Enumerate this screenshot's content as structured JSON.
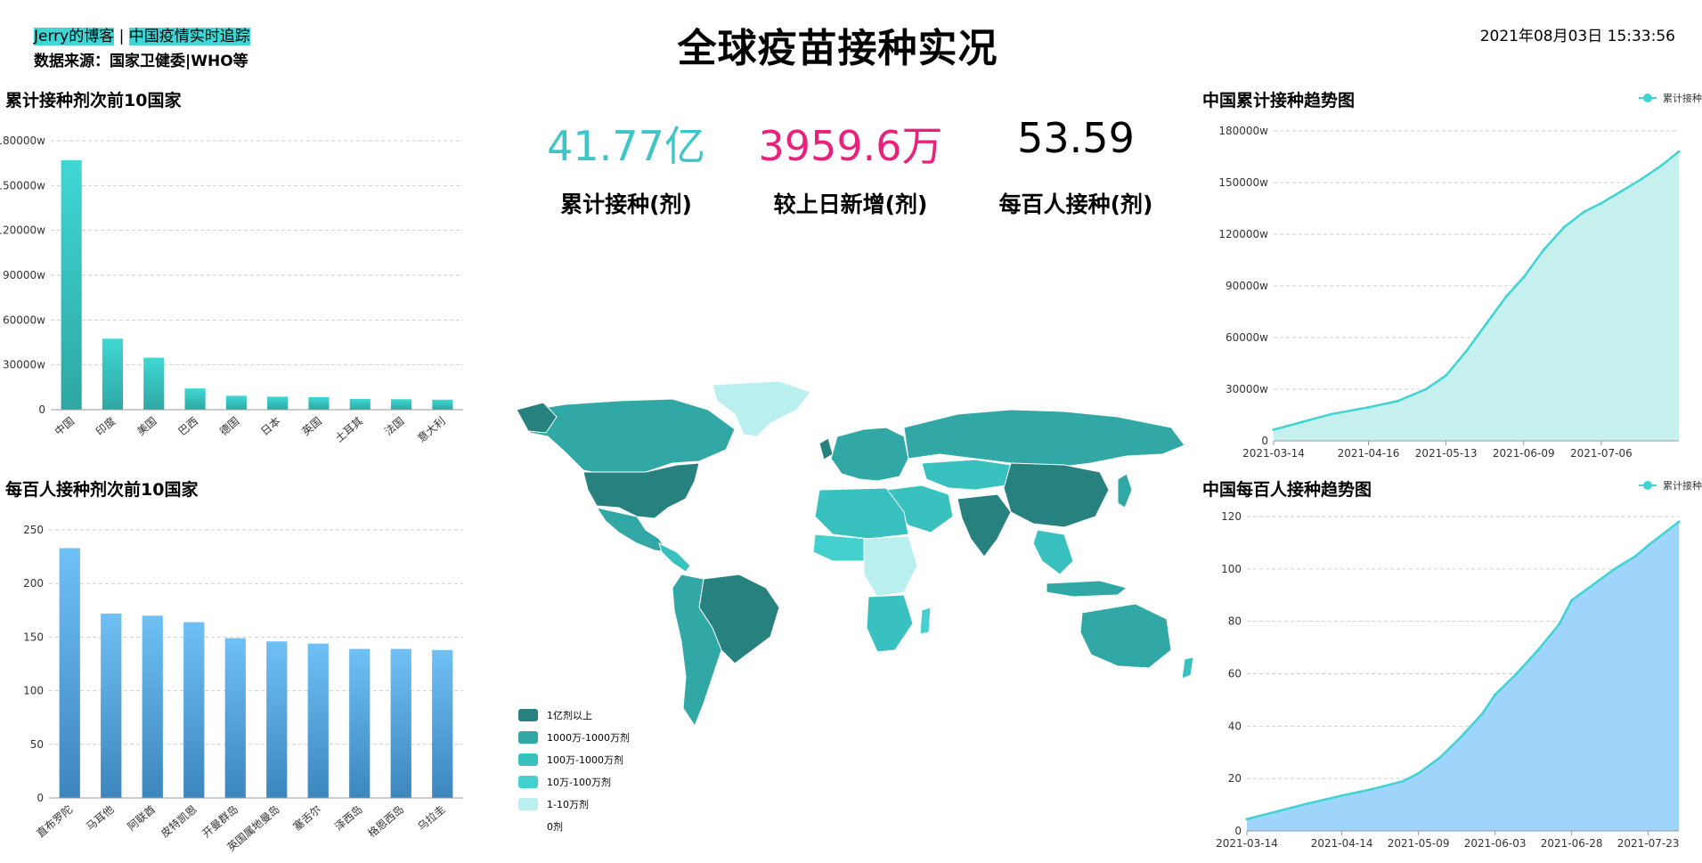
{
  "header": {
    "blog_link": "Jerry的博客",
    "separator": "|",
    "tracker_link": "中国疫情实时追踪",
    "source": "数据来源：国家卫健委|WHO等",
    "title": "全球疫苗接种实况",
    "datetime": "2021年08月03日 15:33:56"
  },
  "kpis": [
    {
      "value": "41.77亿",
      "label": "累计接种(剂)",
      "color": "#3ec5c8"
    },
    {
      "value": "3959.6万",
      "label": "较上日新增(剂)",
      "color": "#e8217a"
    },
    {
      "value": "53.59",
      "label": "每百人接种(剂)",
      "color": "#000000"
    }
  ],
  "colors": {
    "teal_top": "#3fd8d4",
    "teal_bottom": "#2ea7a3",
    "blue_top": "#6fc0f5",
    "blue_bottom": "#3c86bd",
    "line": "#40d3d3",
    "area_teal": "#c6f0ee",
    "area_blue": "#9fd5fb",
    "grid": "#cfcfcf"
  },
  "chart_data": [
    {
      "id": "cum-top10",
      "type": "bar",
      "title": "累计接种剂次前10国家",
      "categories": [
        "中国",
        "印度",
        "美国",
        "巴西",
        "德国",
        "日本",
        "英国",
        "土耳其",
        "法国",
        "意大利"
      ],
      "values": [
        167000,
        47500,
        34800,
        14200,
        9300,
        8700,
        8400,
        7200,
        7000,
        6700
      ],
      "yticks": [
        "0",
        "30000w",
        "60000w",
        "90000w",
        "120000w",
        "150000w",
        "180000w"
      ],
      "ylim": [
        0,
        180000
      ]
    },
    {
      "id": "per100-top10",
      "type": "bar",
      "title": "每百人接种剂次前10国家",
      "categories": [
        "直布罗陀",
        "马耳他",
        "阿联酋",
        "皮特凯恩",
        "开曼群岛",
        "英国属地曼岛",
        "塞舌尔",
        "泽西岛",
        "格恩西岛",
        "乌拉圭"
      ],
      "values": [
        233,
        172,
        170,
        164,
        149,
        146,
        144,
        139,
        139,
        138
      ],
      "yticks": [
        "0",
        "50",
        "100",
        "150",
        "200",
        "250"
      ],
      "ylim": [
        0,
        250
      ]
    },
    {
      "id": "china-cum-trend",
      "type": "area",
      "title": "中国累计接种趋势图",
      "legend": "累计接种",
      "x": [
        "2021-03-14",
        "2021-03-24",
        "2021-04-03",
        "2021-04-16",
        "2021-04-26",
        "2021-05-06",
        "2021-05-13",
        "2021-05-20",
        "2021-05-27",
        "2021-06-03",
        "2021-06-09",
        "2021-06-16",
        "2021-06-23",
        "2021-06-30",
        "2021-07-06",
        "2021-07-13",
        "2021-07-20",
        "2021-07-27",
        "2021-08-02"
      ],
      "values": [
        6500,
        11000,
        15500,
        19500,
        23000,
        30000,
        38000,
        52000,
        68000,
        84000,
        95000,
        111000,
        124000,
        133000,
        138000,
        145000,
        152000,
        160000,
        168000
      ],
      "xticks": [
        "2021-03-14",
        "2021-04-16",
        "2021-05-13",
        "2021-06-09",
        "2021-07-06"
      ],
      "yticks": [
        "0",
        "30000w",
        "60000w",
        "90000w",
        "120000w",
        "150000w",
        "180000w"
      ],
      "ylim": [
        0,
        180000
      ]
    },
    {
      "id": "china-per100-trend",
      "type": "area",
      "title": "中国每百人接种趋势图",
      "legend": "累计接种",
      "x": [
        "2021-03-14",
        "2021-03-24",
        "2021-04-03",
        "2021-04-14",
        "2021-04-24",
        "2021-05-04",
        "2021-05-09",
        "2021-05-16",
        "2021-05-23",
        "2021-05-30",
        "2021-06-03",
        "2021-06-10",
        "2021-06-17",
        "2021-06-24",
        "2021-06-28",
        "2021-07-05",
        "2021-07-12",
        "2021-07-19",
        "2021-07-23",
        "2021-08-02"
      ],
      "values": [
        4.5,
        7.5,
        10.5,
        13.5,
        16,
        19,
        22,
        28,
        36,
        45,
        52,
        60,
        69,
        79,
        88,
        94,
        100,
        105,
        109,
        118
      ],
      "xticks": [
        "2021-03-14",
        "2021-04-14",
        "2021-05-09",
        "2021-06-03",
        "2021-06-28",
        "2021-07-23"
      ],
      "yticks": [
        "0",
        "20",
        "40",
        "60",
        "80",
        "100",
        "120"
      ],
      "ylim": [
        0,
        120
      ]
    }
  ],
  "map_legend": [
    {
      "label": "1亿剂以上",
      "color": "#27827f"
    },
    {
      "label": "1000万-1000万剂",
      "color": "#31a8a6"
    },
    {
      "label": "100万-1000万剂",
      "color": "#38c1bf"
    },
    {
      "label": "10万-100万剂",
      "color": "#44d0cf"
    },
    {
      "label": "1-10万剂",
      "color": "#b9efef"
    },
    {
      "label": "0剂",
      "color": "#ffffff"
    }
  ]
}
